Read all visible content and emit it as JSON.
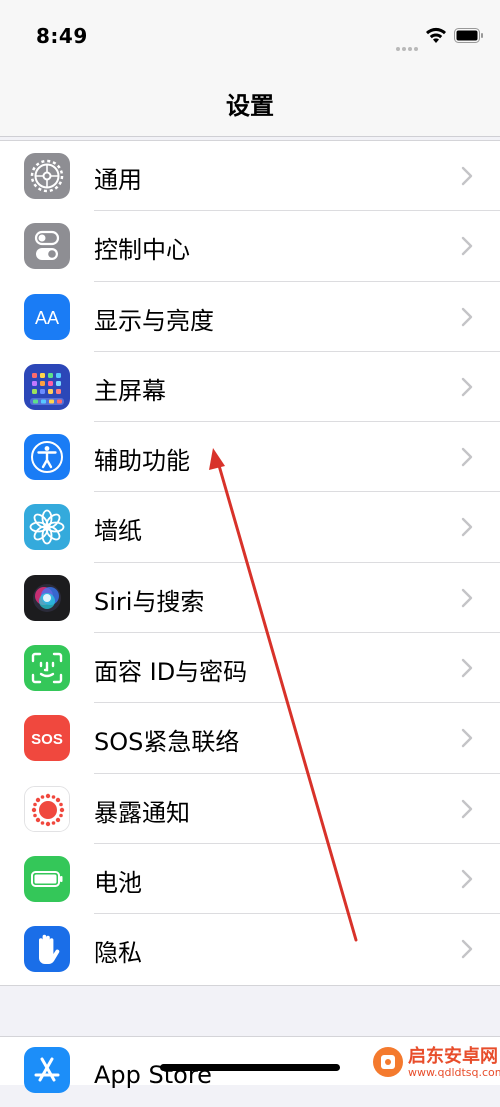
{
  "status_bar": {
    "time": "8:49"
  },
  "header": {
    "title": "设置"
  },
  "settings": {
    "items": [
      {
        "label": "通用",
        "icon": "gear-icon",
        "color": "#8e8e93"
      },
      {
        "label": "控制中心",
        "icon": "toggles-icon",
        "color": "#8e8e93"
      },
      {
        "label": "显示与亮度",
        "icon": "text-size-icon",
        "color": "#1a7cf5",
        "icon_text": "AA"
      },
      {
        "label": "主屏幕",
        "icon": "home-grid-icon",
        "color": "#2c47b8"
      },
      {
        "label": "辅助功能",
        "icon": "accessibility-icon",
        "color": "#1a7cf5"
      },
      {
        "label": "墙纸",
        "icon": "flower-icon",
        "color": "#34aadc"
      },
      {
        "label": "Siri与搜索",
        "icon": "siri-icon",
        "color": "#1c1c1e"
      },
      {
        "label": "面容 ID与密码",
        "icon": "face-id-icon",
        "color": "#34c759"
      },
      {
        "label": "SOS紧急联络",
        "icon": "sos-icon",
        "color": "#f0483e",
        "icon_text": "SOS"
      },
      {
        "label": "暴露通知",
        "icon": "exposure-icon",
        "color": "#ffffff"
      },
      {
        "label": "电池",
        "icon": "battery-icon",
        "color": "#34c759"
      },
      {
        "label": "隐私",
        "icon": "hand-icon",
        "color": "#1a6ee8"
      }
    ],
    "app_store": {
      "label": "App Store",
      "icon": "app-store-icon",
      "color": "#1c8ef9"
    }
  },
  "annotation": {
    "arrow_color": "#d8322a"
  },
  "watermark": {
    "name": "启东安卓网",
    "url": "www.qdldtsq.com"
  }
}
